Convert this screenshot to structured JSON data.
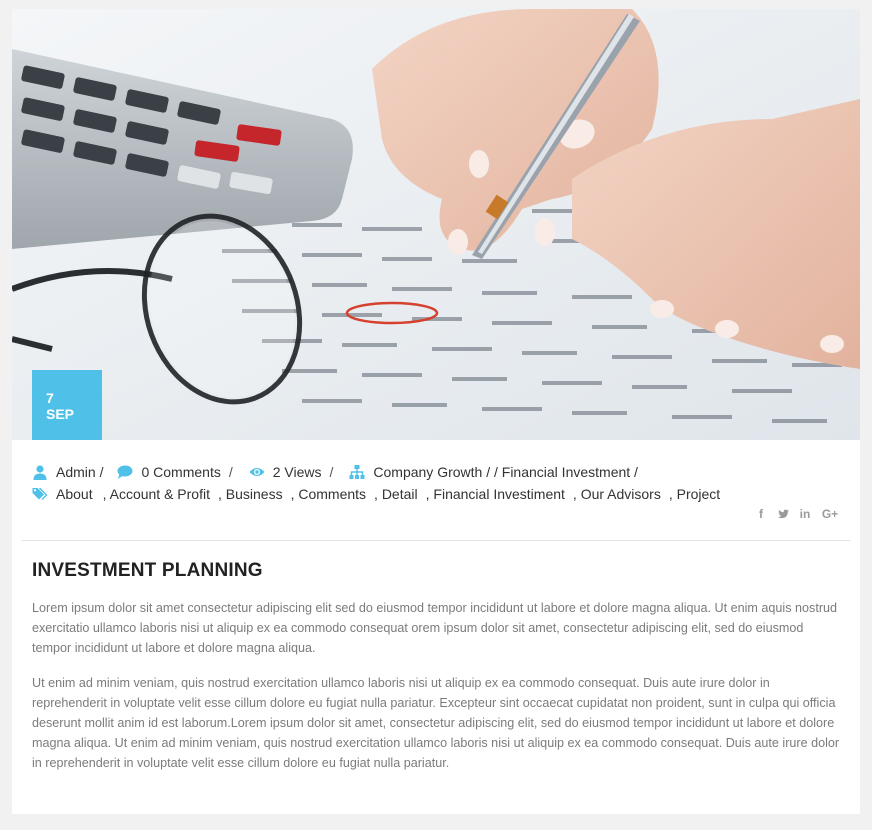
{
  "post": {
    "date_day": "7",
    "date_month": "SEP",
    "author": "Admin /",
    "comments": "0 Comments",
    "comments_sep": "/",
    "views": "2 Views",
    "views_sep": "/",
    "categories_label": "Company Growth / / Financial Investment /",
    "tags": [
      "About",
      ", Account & Profit",
      ", Business",
      ", Comments",
      ", Detail",
      ", Financial Investiment",
      ", Our Advisors",
      ", Project"
    ],
    "title": "INVESTMENT PLANNING",
    "paragraphs": [
      "Lorem ipsum dolor sit amet consectetur adipiscing elit sed do eiusmod tempor incididunt ut labore et dolore magna aliqua. Ut enim aquis nostrud exercitatio ullamco laboris nisi ut aliquip ex ea commodo consequat orem ipsum dolor sit amet, consectetur adipiscing elit, sed do eiusmod tempor incididunt ut labore et dolore magna aliqua.",
      "Ut enim ad minim veniam, quis nostrud exercitation ullamco laboris nisi ut aliquip ex ea commodo consequat. Duis aute irure dolor in reprehenderit in voluptate velit esse cillum dolore eu fugiat nulla pariatur. Excepteur sint occaecat cupidatat non proident, sunt in culpa qui officia deserunt mollit anim id est laborum.Lorem ipsum dolor sit amet, consectetur adipiscing elit, sed do eiusmod tempor incididunt ut labore et dolore magna aliqua. Ut enim ad minim veniam, quis nostrud exercitation ullamco laboris nisi ut aliquip ex ea commodo consequat. Duis aute irure dolor in reprehenderit in voluptate velit esse cillum dolore eu fugiat nulla pariatur."
    ]
  },
  "share": {
    "facebook": "f",
    "linkedin": "in",
    "googleplus": "G+"
  },
  "icons": [
    "user-icon",
    "comment-icon",
    "eye-icon",
    "sitemap-icon",
    "tags-icon",
    "facebook-icon",
    "twitter-icon",
    "linkedin-icon",
    "google-plus-icon"
  ],
  "colors": {
    "accent": "#4fc1e9",
    "meta_icon": "#4fc1e9",
    "share_icon": "#9a9a9a",
    "text": "#333333",
    "body_text": "#7b7b7b",
    "page_background": "#f1f1f1"
  }
}
